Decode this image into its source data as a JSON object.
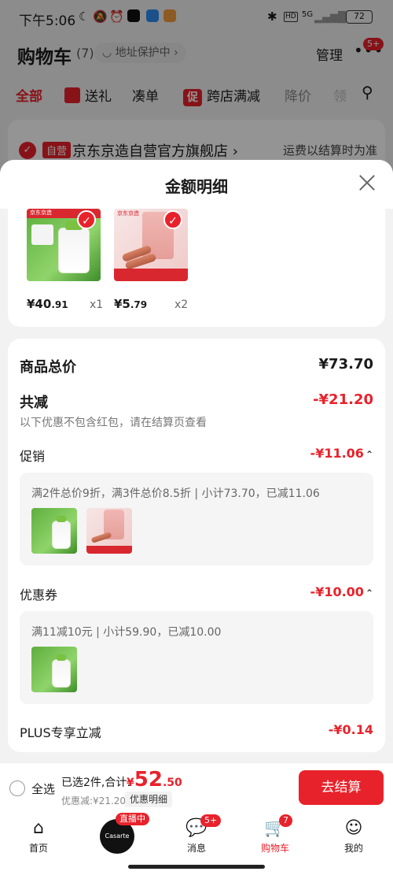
{
  "status_bar": {
    "time": "下午5:06",
    "network": "5G",
    "battery": "72"
  },
  "header": {
    "title": "购物车",
    "count": "(7)",
    "address_protection": "地址保护中",
    "manage": "管理",
    "more_badge": "5+"
  },
  "tabs": [
    {
      "label": "全部"
    },
    {
      "label": "送礼"
    },
    {
      "label": "凑单"
    },
    {
      "label": "促",
      "tag": true
    },
    {
      "label": "跨店满减"
    },
    {
      "label": "降价"
    },
    {
      "label": "领"
    }
  ],
  "store": {
    "self_tag": "自营",
    "name": "京东京造自营官方旗舰店",
    "shipping_note": "运费以结算时为准"
  },
  "sheet": {
    "title": "金额明细",
    "items": [
      {
        "brand": "京东京造",
        "price_int": "¥40",
        "price_dec": ".91",
        "qty": "x1"
      },
      {
        "brand": "京东京造",
        "price_int": "¥5",
        "price_dec": ".79",
        "qty": "x2"
      }
    ],
    "total_label": "商品总价",
    "total_value": "¥73.70",
    "reduce_label": "共减",
    "reduce_value": "-¥21.20",
    "reduce_note": "以下优惠不包含红包，请在结算页查看",
    "promo": {
      "label": "促销",
      "value": "-¥11.06",
      "condition": "满2件总价9折，满3件总价8.5折 | 小计73.70，已减11.06"
    },
    "coupon": {
      "label": "优惠券",
      "value": "-¥10.00",
      "condition": "满11减10元 | 小计59.90，已减10.00"
    },
    "plus": {
      "label": "PLUS专享立减",
      "value": "-¥0.14"
    }
  },
  "footer": {
    "select_all": "全选",
    "selected_text": "已选2件,合计:",
    "amount_symbol": "¥",
    "amount_int": "52",
    "amount_dec": ".50",
    "discount_text": "优惠减:¥21.20",
    "discount_detail": "优惠明细",
    "checkout": "去结算"
  },
  "nav": {
    "items": [
      {
        "label": "首页"
      },
      {
        "label": "消息"
      },
      {
        "label": "购物车"
      },
      {
        "label": "我的"
      }
    ],
    "live_tag": "直播中",
    "live_brand": "Casarte",
    "message_badge": "5+",
    "cart_badge": "7"
  },
  "colors": {
    "accent": "#e8222b"
  }
}
